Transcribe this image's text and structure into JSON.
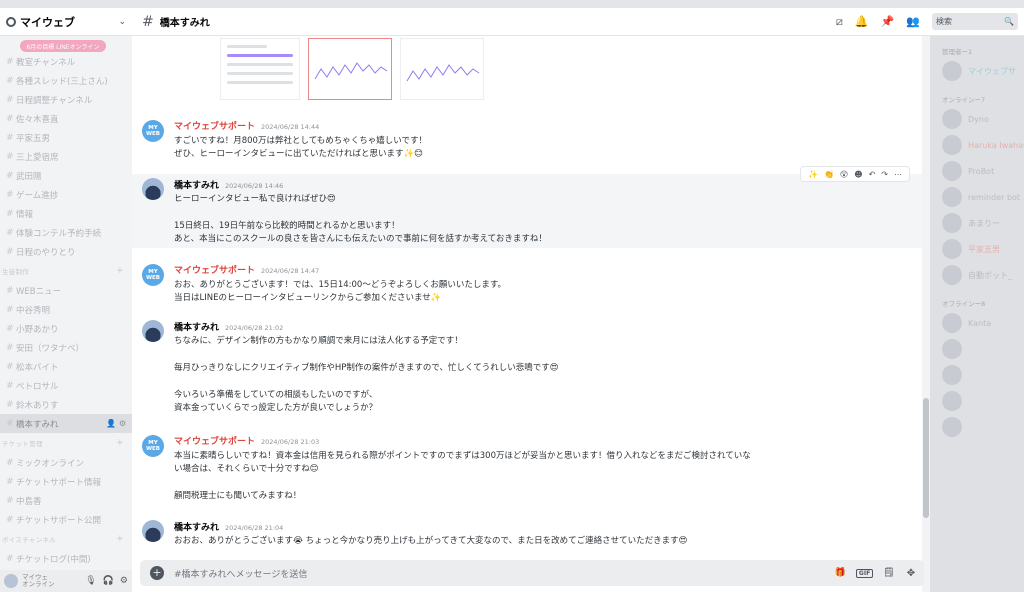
{
  "server": {
    "name": "マイウェブ"
  },
  "sidebar": {
    "pill": "6月の目標 LINEオンライン",
    "channels": [
      {
        "label": "教室チャンネル",
        "type": "channel"
      },
      {
        "label": "各種スレッド(三上さん)",
        "type": "channel"
      },
      {
        "label": "日程調整チャンネル",
        "type": "channel"
      },
      {
        "label": "佐々木喜直",
        "type": "channel"
      },
      {
        "label": "平家五男",
        "type": "channel"
      },
      {
        "label": "三上愛宿席",
        "type": "channel"
      },
      {
        "label": "武田陽",
        "type": "channel"
      },
      {
        "label": "ゲーム進捗",
        "type": "channel"
      },
      {
        "label": "情報",
        "type": "channel"
      },
      {
        "label": "体験コンテル予約手続",
        "type": "channel"
      },
      {
        "label": "日程のやりとり",
        "type": "channel"
      },
      {
        "label": "生徒制作",
        "type": "category"
      },
      {
        "label": "WEBニュー",
        "type": "channel"
      },
      {
        "label": "中谷秀明",
        "type": "channel"
      },
      {
        "label": "小野あかり",
        "type": "channel"
      },
      {
        "label": "安田（ワタナベ）",
        "type": "channel"
      },
      {
        "label": "松本バイト",
        "type": "channel"
      },
      {
        "label": "ぺトロサル",
        "type": "channel"
      },
      {
        "label": "鈴木ありす",
        "type": "channel"
      },
      {
        "label": "橋本すみれ",
        "type": "channel",
        "active": true
      },
      {
        "label": "チケット管理",
        "type": "category"
      },
      {
        "label": "ミックオンライン",
        "type": "channel"
      },
      {
        "label": "チケットサポート情報",
        "type": "channel"
      },
      {
        "label": "中島香",
        "type": "channel"
      },
      {
        "label": "チケットサポート公開",
        "type": "channel"
      },
      {
        "label": "ボイスチャンネル",
        "type": "category"
      },
      {
        "label": "チケットログ(中間)",
        "type": "channel"
      }
    ],
    "user": {
      "name": "マイウェ",
      "status": "オンライン"
    }
  },
  "header": {
    "channel_name": "橋本すみれ",
    "search_placeholder": "検索",
    "icons": [
      "threads-icon",
      "bell-icon",
      "pin-icon",
      "members-icon"
    ]
  },
  "messages": [
    {
      "author": "マイウェブサポート",
      "author_type": "support",
      "avatar_text": "MY WEB",
      "timestamp": "2024/06/28 14:44",
      "lines": [
        "すごいですね！月800万は弊社としてもめちゃくちゃ嬉しいです！",
        "ぜひ、ヒーローインタビューに出ていただければと思います✨😊"
      ]
    },
    {
      "author": "橋本すみれ",
      "author_type": "user",
      "timestamp": "2024/06/28 14:46",
      "hovered": true,
      "lines": [
        "ヒーローインタビュー私で良ければぜひ😍",
        "",
        "15日終日、19日午前なら比較的時間とれるかと思います！",
        "あと、本当にこのスクールの良さを皆さんにも伝えたいので事前に何を話すか考えておきますね！"
      ]
    },
    {
      "author": "マイウェブサポート",
      "author_type": "support",
      "avatar_text": "MY WEB",
      "timestamp": "2024/06/28 14:47",
      "lines": [
        "おお、ありがとうございます！では、15日14:00〜どうぞよろしくお願いいたします。",
        "当日はLINEのヒーローインタビューリンクからご参加くださいませ✨"
      ]
    },
    {
      "author": "橋本すみれ",
      "author_type": "user",
      "timestamp": "2024/06/28 21:02",
      "lines": [
        "ちなみに、デザイン制作の方もかなり順調で来月には法人化する予定です！",
        "",
        "毎月ひっきりなしにクリエイティブ制作やHP制作の案件がきますので、忙しくてうれしい悲鳴です😍",
        "",
        "今いろいろ準備をしていての相談もしたいのですが、",
        "資本金っていくらでっ設定した方が良いでしょうか？"
      ]
    },
    {
      "author": "マイウェブサポート",
      "author_type": "support",
      "avatar_text": "MY WEB",
      "timestamp": "2024/06/28 21:03",
      "lines": [
        "本当に素晴らしいですね！資本金は信用を見られる際がポイントですのでまずは300万ほどが妥当かと思います！借り入れなどをまだご検討されていな",
        "い場合は、それくらいで十分ですね😊",
        "",
        "顧問税理士にも聞いてみますね！"
      ]
    },
    {
      "author": "橋本すみれ",
      "author_type": "user",
      "timestamp": "2024/06/28 21:04",
      "lines": [
        "おおお、ありがとうございます😭 ちょっと今かなり売り上げも上がってきて大変なので、また日を改めてご連絡させていただきます😍"
      ]
    }
  ],
  "message_toolbar": {
    "reactions": [
      "✨",
      "👏",
      "😲"
    ],
    "icons": [
      "add-reaction-icon",
      "reply-icon",
      "forward-icon",
      "more-icon"
    ]
  },
  "composer": {
    "placeholder": "#橋本すみれへメッセージを送信",
    "gif_label": "GIF"
  },
  "members": {
    "categories": [
      "管理者ー1",
      "オンラインー7",
      "オフラインー8"
    ],
    "list": [
      {
        "name": "マイウェブサ",
        "color": "teal"
      },
      {
        "name": "Dyno",
        "color": "grey"
      },
      {
        "name": "Haruka Iwahashi",
        "color": "red"
      },
      {
        "name": "ProBot",
        "color": "grey"
      },
      {
        "name": "reminder bot",
        "color": "grey"
      },
      {
        "name": "あまりー",
        "color": "grey"
      },
      {
        "name": "平家五男",
        "color": "red"
      },
      {
        "name": "自動ボット_",
        "color": "grey"
      },
      {
        "name": "Kanta",
        "color": "grey"
      },
      {
        "name": "",
        "color": "grey"
      },
      {
        "name": "",
        "color": "grey"
      },
      {
        "name": "",
        "color": "grey"
      },
      {
        "name": "",
        "color": "grey"
      }
    ]
  },
  "colors": {
    "support_name": "#e0433a",
    "avatar_blue": "#5aa8e6",
    "accent_pink": "#f47fa1"
  }
}
